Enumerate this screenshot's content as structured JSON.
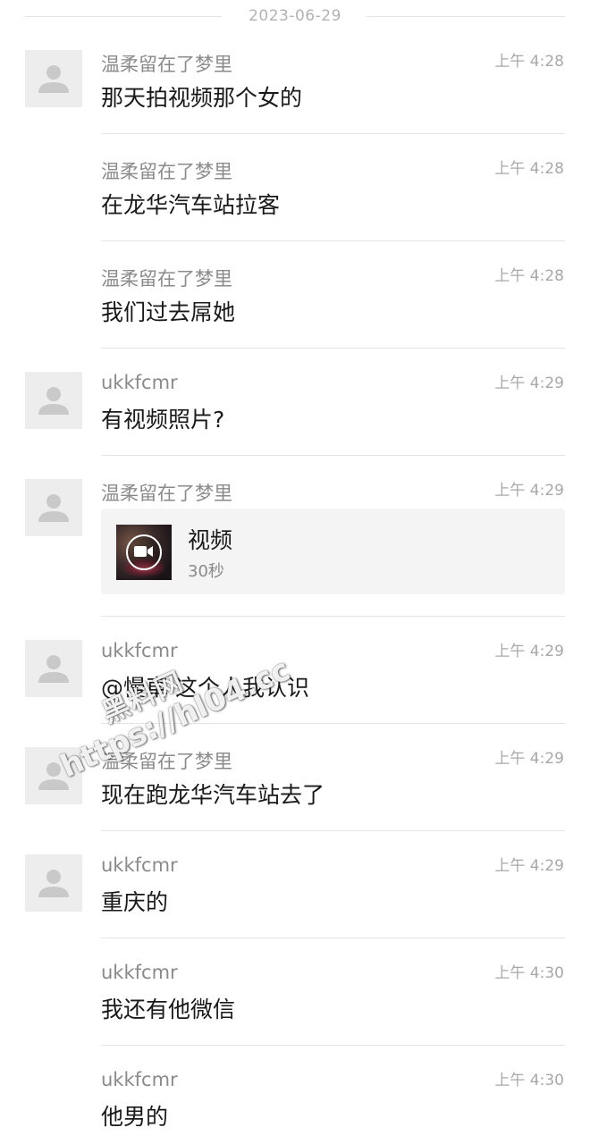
{
  "date_separator": "2023-06-29",
  "messages": [
    {
      "sender": "温柔留在了梦里",
      "time": "上午 4:28",
      "text": "那天拍视频那个女的",
      "avatar": true
    },
    {
      "sender": "温柔留在了梦里",
      "time": "上午 4:28",
      "text": "在龙华汽车站拉客",
      "avatar": false
    },
    {
      "sender": "温柔留在了梦里",
      "time": "上午 4:28",
      "text": "我们过去屌她",
      "avatar": false
    },
    {
      "sender": "ukkfcmr",
      "time": "上午 4:29",
      "text": "有视频照片?",
      "avatar": true
    },
    {
      "sender": "温柔留在了梦里",
      "time": "上午 4:29",
      "avatar": true,
      "video": {
        "title": "视频",
        "duration": "30秒",
        "icon": "video-camera-icon"
      }
    },
    {
      "sender": "ukkfcmr",
      "time": "上午 4:29",
      "text": "@慢車 这个人我认识",
      "avatar": true
    },
    {
      "sender": "温柔留在了梦里",
      "time": "上午 4:29",
      "text": "现在跑龙华汽车站去了",
      "avatar": true
    },
    {
      "sender": "ukkfcmr",
      "time": "上午 4:29",
      "text": "重庆的",
      "avatar": true
    },
    {
      "sender": "ukkfcmr",
      "time": "上午 4:30",
      "text": "我还有他微信",
      "avatar": false
    },
    {
      "sender": "ukkfcmr",
      "time": "上午 4:30",
      "text": "他男的",
      "avatar": false
    }
  ],
  "watermark": {
    "line1": "黑料网",
    "line2": "https://hl04.cc"
  },
  "colors": {
    "sender": "#8a8a8a",
    "time": "#a8a8a8",
    "text": "#191919",
    "avatar_bg": "#ededed",
    "divider": "#e5e5e5"
  }
}
